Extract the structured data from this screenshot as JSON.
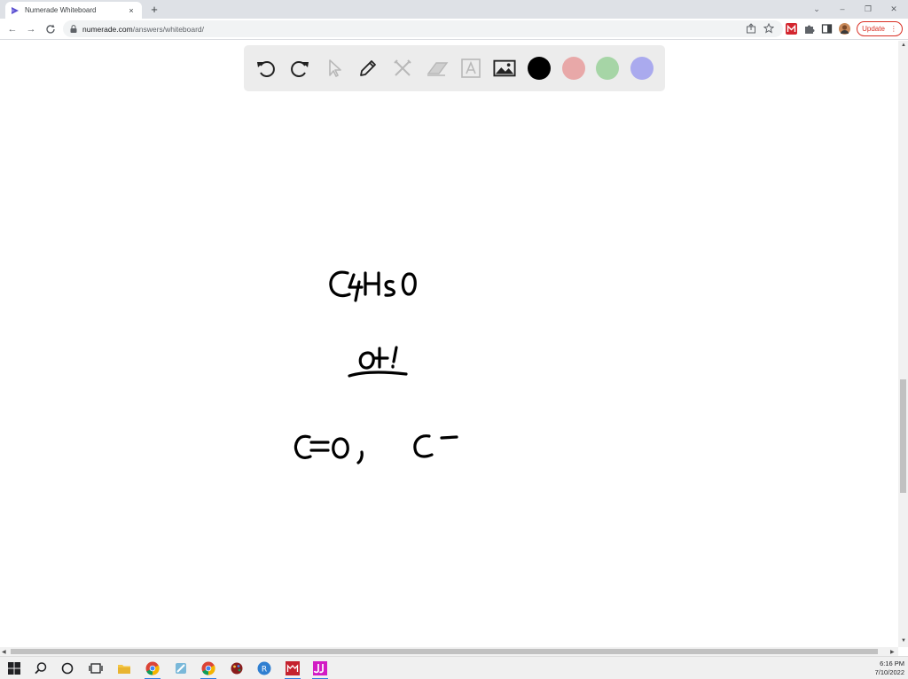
{
  "browser": {
    "tab": {
      "title": "Numerade Whiteboard",
      "close": "×"
    },
    "new_tab": "+",
    "window_controls": {
      "dropdown": "⌄",
      "minimize": "–",
      "restore": "❐",
      "close": "✕"
    },
    "nav": {
      "back": "←",
      "forward": "→",
      "reload": "C"
    },
    "address": {
      "host": "numerade.com",
      "path": "/answers/whiteboard/"
    },
    "update_label": "Update",
    "menu_glyph": "⋮"
  },
  "whiteboard": {
    "tools": [
      {
        "name": "undo-icon"
      },
      {
        "name": "redo-icon"
      },
      {
        "name": "cursor-icon"
      },
      {
        "name": "pen-icon"
      },
      {
        "name": "tools-icon"
      },
      {
        "name": "eraser-icon"
      },
      {
        "name": "text-icon"
      },
      {
        "name": "image-icon"
      }
    ],
    "colors": {
      "panel": "#ececec",
      "black": "#000000",
      "red": "#e8a8a8",
      "green": "#a6d5a6",
      "blue": "#aaaaee"
    },
    "handwriting": {
      "line1": "C4H8O",
      "line2": "OH!",
      "line3a": "C=O,",
      "line3b": "C-"
    }
  },
  "taskbar": {
    "time": "6:16 PM",
    "date": "7/10/2022"
  }
}
